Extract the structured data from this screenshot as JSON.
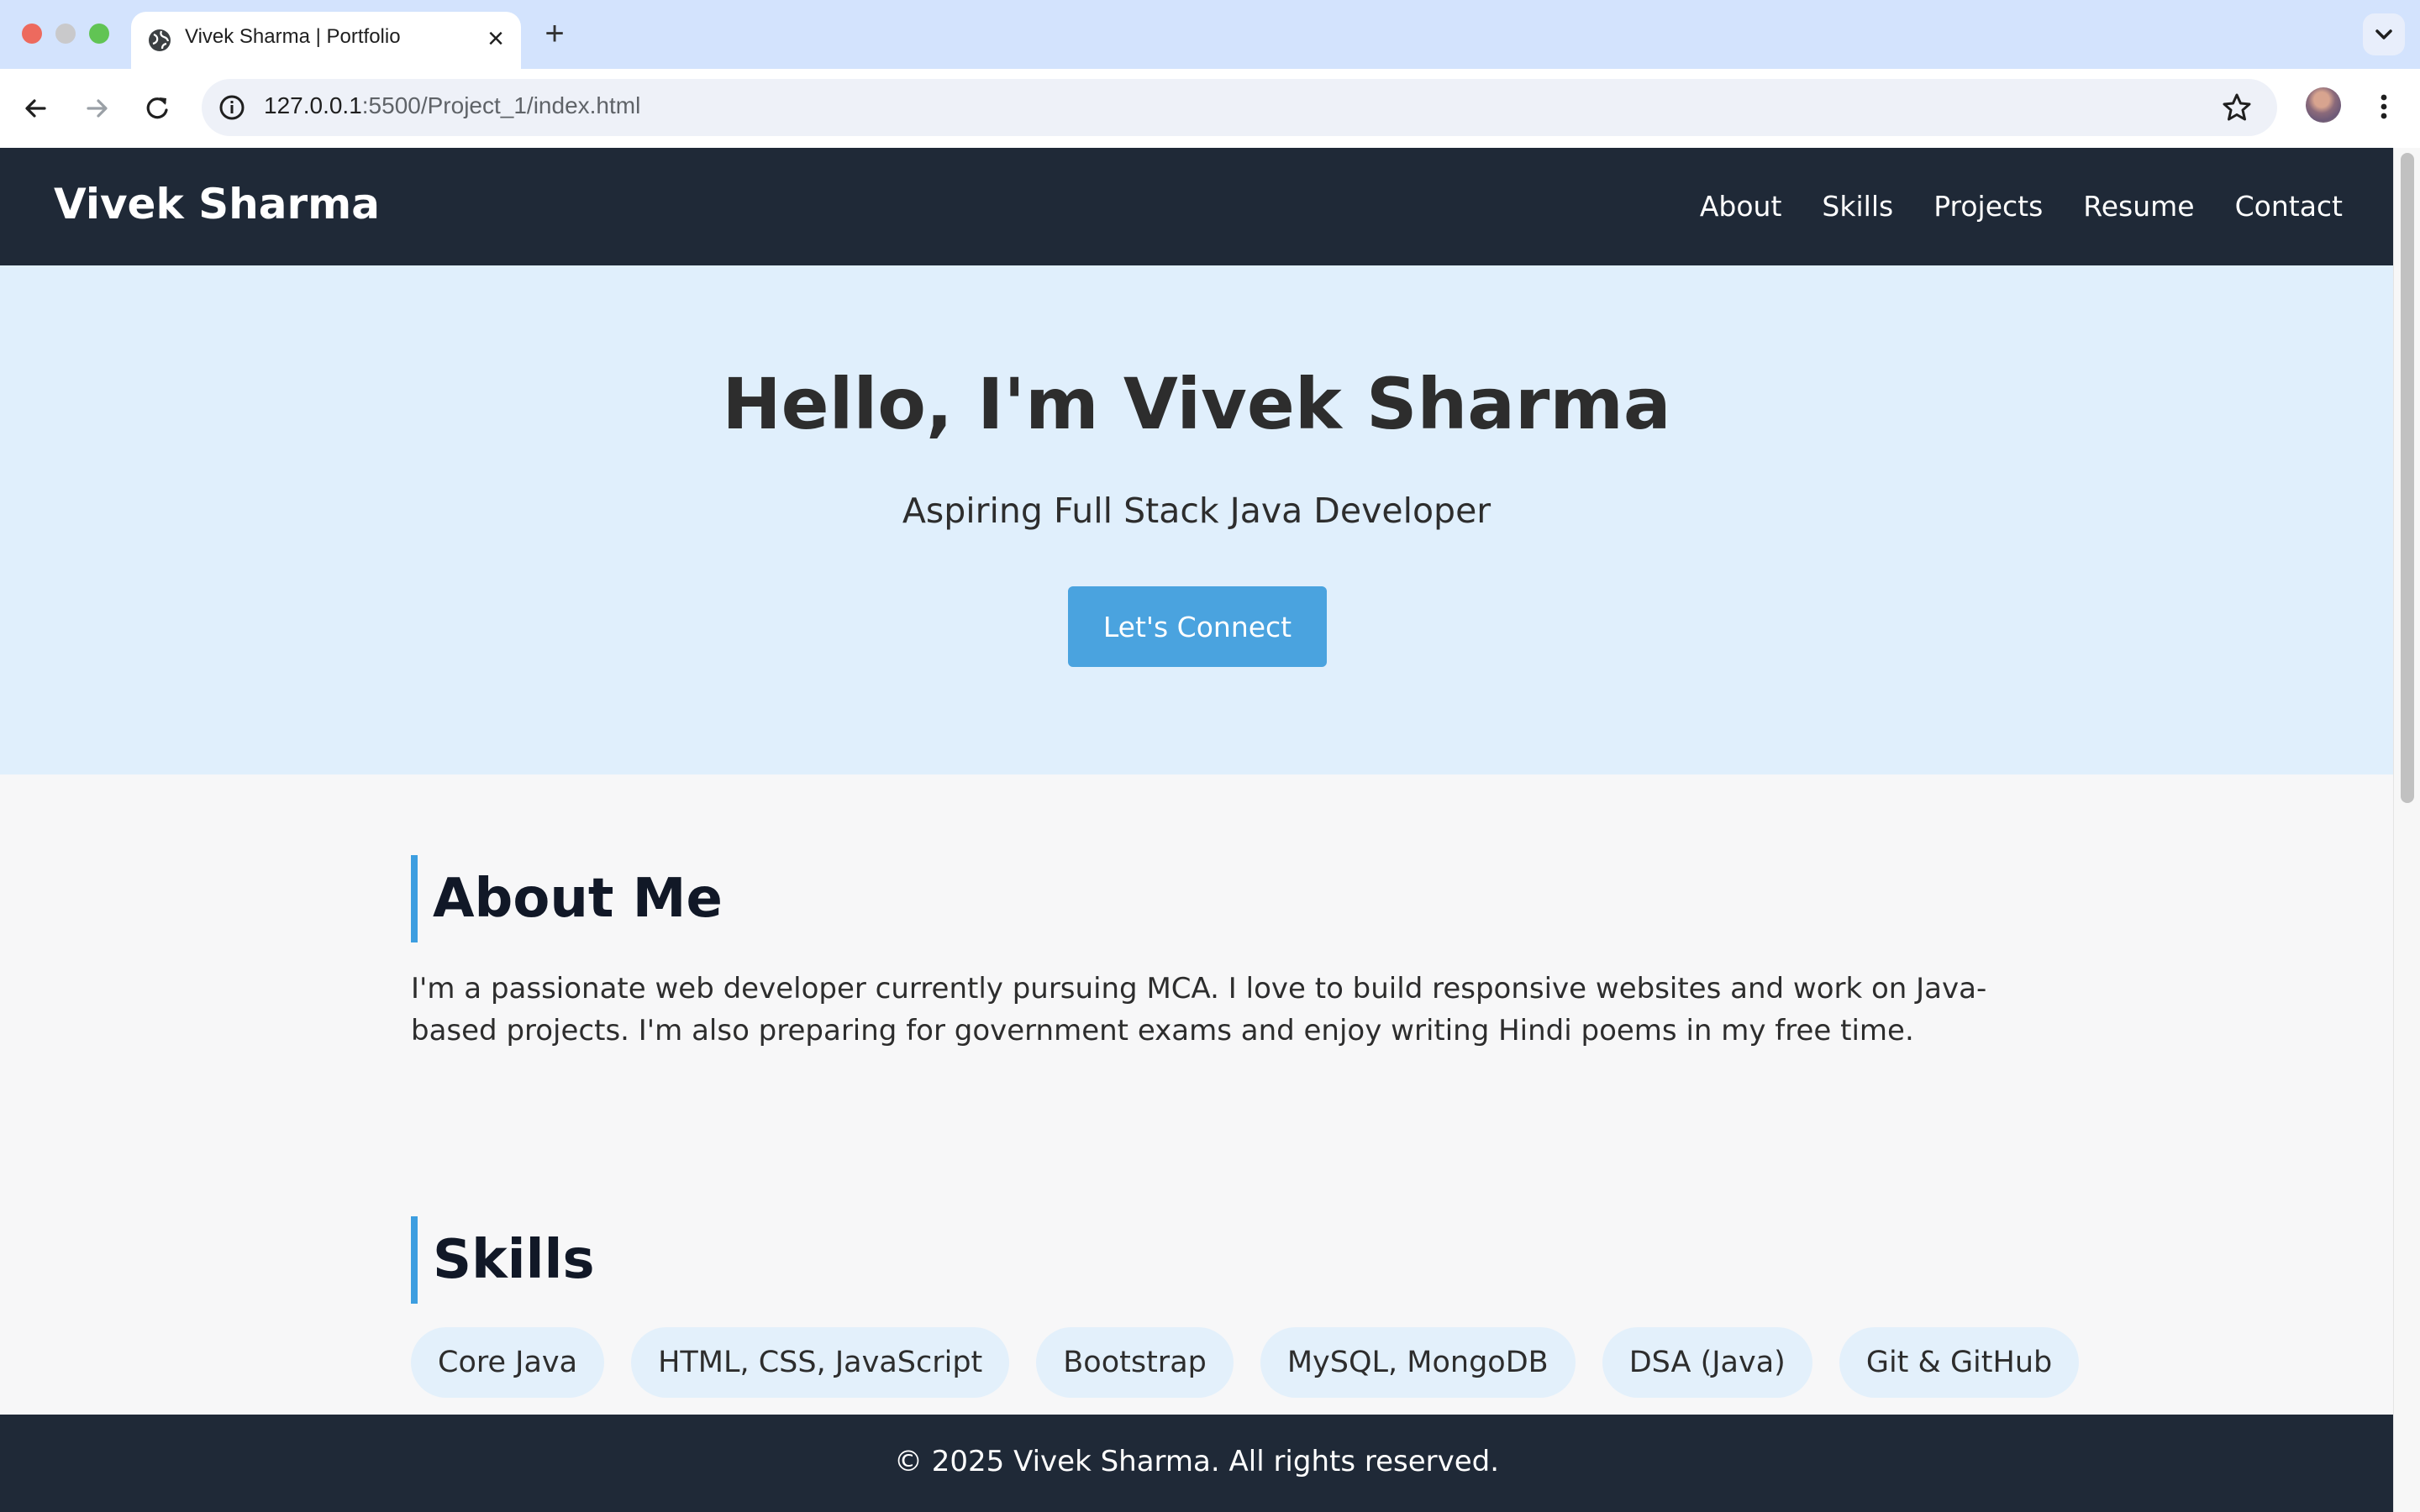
{
  "browser": {
    "tab_title": "Vivek Sharma | Portfolio",
    "tab_close": "×",
    "new_tab": "+",
    "url_host": "127.0.0.1",
    "url_rest": ":5500/Project_1/index.html"
  },
  "nav": {
    "brand": "Vivek Sharma",
    "links": [
      "About",
      "Skills",
      "Projects",
      "Resume",
      "Contact"
    ]
  },
  "hero": {
    "title": "Hello, I'm Vivek Sharma",
    "subtitle": "Aspiring Full Stack Java Developer",
    "cta_label": "Let's Connect",
    "cta_color": "#4aa3df"
  },
  "about": {
    "heading": "About Me",
    "text": "I'm a passionate web developer currently pursuing MCA. I love to build responsive websites and work on Java-based projects. I'm also preparing for government exams and enjoy writing Hindi poems in my free time."
  },
  "skills": {
    "heading": "Skills",
    "items": [
      "Core Java",
      "HTML, CSS, JavaScript",
      "Bootstrap",
      "MySQL, MongoDB",
      "DSA (Java)",
      "Git & GitHub"
    ]
  },
  "footer": {
    "text": "© 2025 Vivek Sharma. All rights reserved."
  },
  "colors": {
    "header_bg": "#1f2937",
    "hero_bg": "#e0effc",
    "accent": "#3d9ee0",
    "skill_bg": "#e3f0fb"
  }
}
